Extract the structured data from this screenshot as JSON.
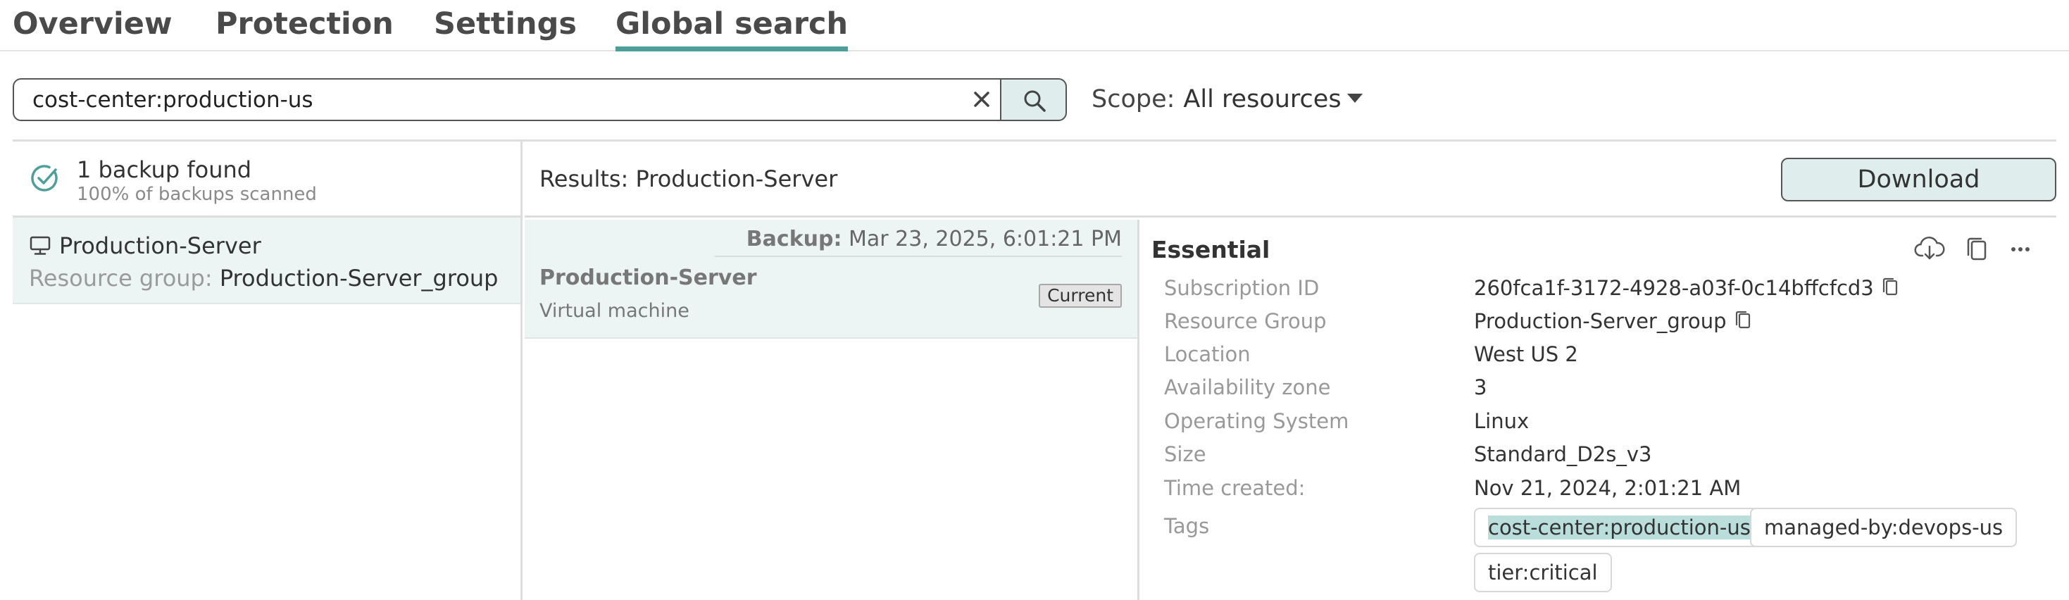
{
  "tabs": [
    {
      "label": "Overview",
      "active": false
    },
    {
      "label": "Protection",
      "active": false
    },
    {
      "label": "Settings",
      "active": false
    },
    {
      "label": "Global search",
      "active": true
    }
  ],
  "search": {
    "value": "cost-center:production-us",
    "clear_icon": "close-icon",
    "button_icon": "search-icon"
  },
  "scope": {
    "label": "Scope:",
    "value": "All resources"
  },
  "summary": {
    "title": "1 backup found",
    "subtitle": "100% of backups scanned",
    "icon": "check-circle-icon"
  },
  "resource": {
    "name": "Production-Server",
    "group_label": "Resource group:",
    "group_value": "Production-Server_group",
    "icon": "monitor-icon"
  },
  "results": {
    "title": "Results: Production-Server",
    "download_label": "Download"
  },
  "backup": {
    "date_label": "Backup:",
    "date_value": "Mar 23, 2025, 6:01:21 PM",
    "name": "Production-Server",
    "type": "Virtual machine",
    "badge": "Current"
  },
  "details": {
    "title": "Essential",
    "actions": [
      "cloud-download-icon",
      "copy-icon",
      "more-icon"
    ],
    "fields": [
      {
        "key": "Subscription ID",
        "value": "260fca1f-3172-4928-a03f-0c14bffcfcd3",
        "copyable": true
      },
      {
        "key": "Resource Group",
        "value": "Production-Server_group",
        "copyable": true
      },
      {
        "key": "Location",
        "value": "West US 2",
        "copyable": false
      },
      {
        "key": "Availability zone",
        "value": "3",
        "copyable": false
      },
      {
        "key": "Operating System",
        "value": "Linux",
        "copyable": false
      },
      {
        "key": "Size",
        "value": "Standard_D2s_v3",
        "copyable": false
      },
      {
        "key": "Time created:",
        "value": "Nov 21, 2024, 2:01:21 AM",
        "copyable": false
      }
    ],
    "tags_label": "Tags",
    "tags": [
      "cost-center:production-us",
      "managed-by:devops-us",
      "tier:critical"
    ],
    "highlighted_tag": "cost-center:production-us"
  },
  "colors": {
    "accent": "#4e9e9a",
    "selected_bg": "#edf4f4",
    "button_bg": "#dfeeed",
    "tag_highlight": "#b9dedc"
  }
}
